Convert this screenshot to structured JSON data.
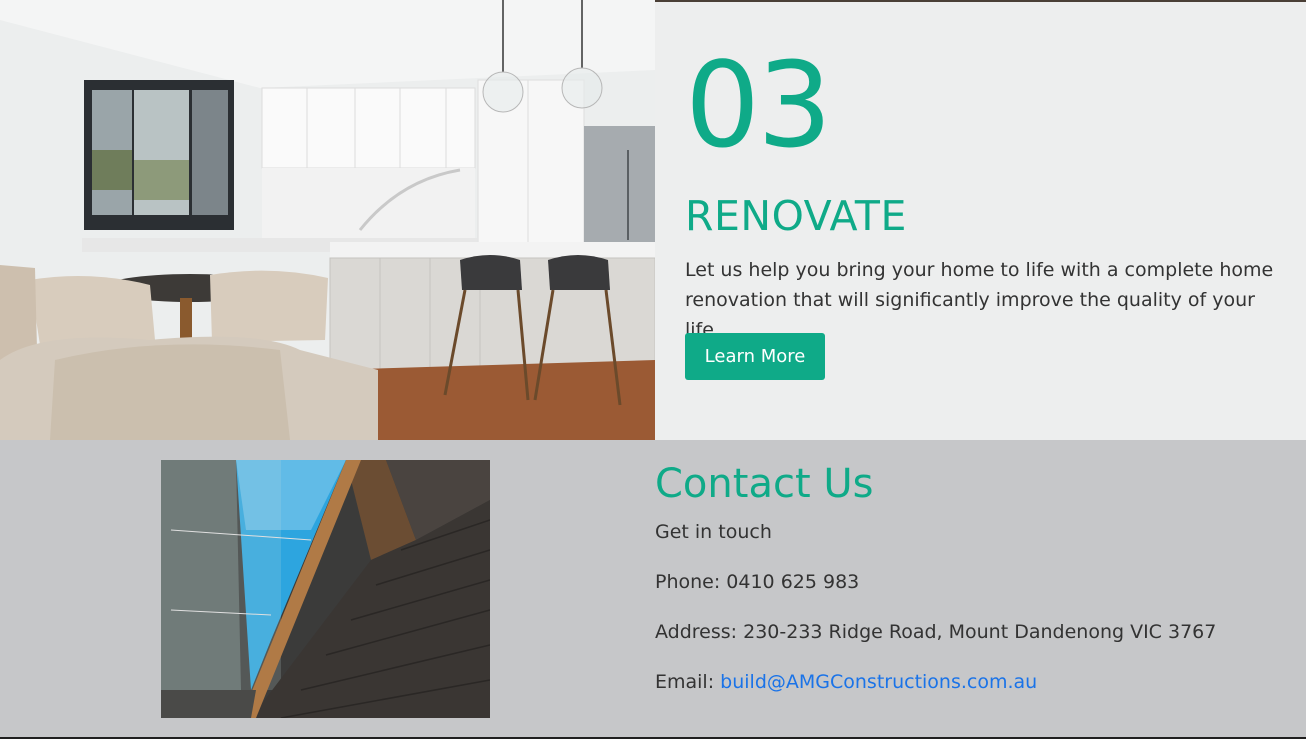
{
  "renovate": {
    "number": "03",
    "title": "RENOVATE",
    "description": "Let us help you bring your home to life with a complete home renovation that will significantly improve the quality of your life.",
    "button_label": "Learn More"
  },
  "contact": {
    "title": "Contact Us",
    "tagline": "Get in touch",
    "phone": "Phone: 0410 625 983",
    "address": "Address: 230-233 Ridge Road, Mount Dandenong VIC 3767",
    "email_prefix": "Email: ",
    "email": "build@AMGConstructions.com.au"
  },
  "colors": {
    "accent": "#0faa88",
    "panel_bg": "#edeeee",
    "contact_bg": "#c6c7c9",
    "link": "#1a73e8"
  }
}
